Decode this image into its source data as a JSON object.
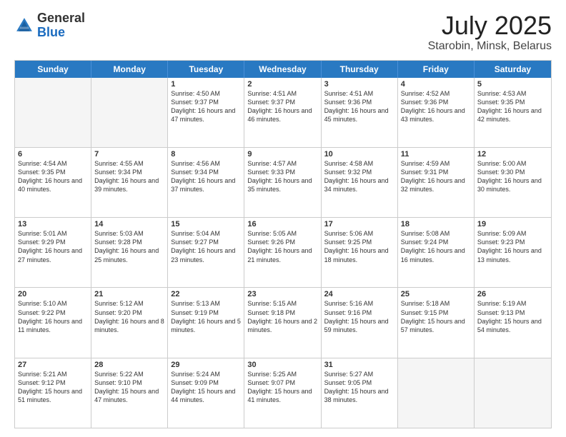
{
  "header": {
    "logo_line1": "General",
    "logo_line2": "Blue",
    "title": "July 2025",
    "subtitle": "Starobin, Minsk, Belarus"
  },
  "calendar": {
    "days": [
      "Sunday",
      "Monday",
      "Tuesday",
      "Wednesday",
      "Thursday",
      "Friday",
      "Saturday"
    ],
    "rows": [
      [
        {
          "day": "",
          "sunrise": "",
          "sunset": "",
          "daylight": "",
          "empty": true
        },
        {
          "day": "",
          "sunrise": "",
          "sunset": "",
          "daylight": "",
          "empty": true
        },
        {
          "day": "1",
          "sunrise": "Sunrise: 4:50 AM",
          "sunset": "Sunset: 9:37 PM",
          "daylight": "Daylight: 16 hours and 47 minutes."
        },
        {
          "day": "2",
          "sunrise": "Sunrise: 4:51 AM",
          "sunset": "Sunset: 9:37 PM",
          "daylight": "Daylight: 16 hours and 46 minutes."
        },
        {
          "day": "3",
          "sunrise": "Sunrise: 4:51 AM",
          "sunset": "Sunset: 9:36 PM",
          "daylight": "Daylight: 16 hours and 45 minutes."
        },
        {
          "day": "4",
          "sunrise": "Sunrise: 4:52 AM",
          "sunset": "Sunset: 9:36 PM",
          "daylight": "Daylight: 16 hours and 43 minutes."
        },
        {
          "day": "5",
          "sunrise": "Sunrise: 4:53 AM",
          "sunset": "Sunset: 9:35 PM",
          "daylight": "Daylight: 16 hours and 42 minutes."
        }
      ],
      [
        {
          "day": "6",
          "sunrise": "Sunrise: 4:54 AM",
          "sunset": "Sunset: 9:35 PM",
          "daylight": "Daylight: 16 hours and 40 minutes."
        },
        {
          "day": "7",
          "sunrise": "Sunrise: 4:55 AM",
          "sunset": "Sunset: 9:34 PM",
          "daylight": "Daylight: 16 hours and 39 minutes."
        },
        {
          "day": "8",
          "sunrise": "Sunrise: 4:56 AM",
          "sunset": "Sunset: 9:34 PM",
          "daylight": "Daylight: 16 hours and 37 minutes."
        },
        {
          "day": "9",
          "sunrise": "Sunrise: 4:57 AM",
          "sunset": "Sunset: 9:33 PM",
          "daylight": "Daylight: 16 hours and 35 minutes."
        },
        {
          "day": "10",
          "sunrise": "Sunrise: 4:58 AM",
          "sunset": "Sunset: 9:32 PM",
          "daylight": "Daylight: 16 hours and 34 minutes."
        },
        {
          "day": "11",
          "sunrise": "Sunrise: 4:59 AM",
          "sunset": "Sunset: 9:31 PM",
          "daylight": "Daylight: 16 hours and 32 minutes."
        },
        {
          "day": "12",
          "sunrise": "Sunrise: 5:00 AM",
          "sunset": "Sunset: 9:30 PM",
          "daylight": "Daylight: 16 hours and 30 minutes."
        }
      ],
      [
        {
          "day": "13",
          "sunrise": "Sunrise: 5:01 AM",
          "sunset": "Sunset: 9:29 PM",
          "daylight": "Daylight: 16 hours and 27 minutes."
        },
        {
          "day": "14",
          "sunrise": "Sunrise: 5:03 AM",
          "sunset": "Sunset: 9:28 PM",
          "daylight": "Daylight: 16 hours and 25 minutes."
        },
        {
          "day": "15",
          "sunrise": "Sunrise: 5:04 AM",
          "sunset": "Sunset: 9:27 PM",
          "daylight": "Daylight: 16 hours and 23 minutes."
        },
        {
          "day": "16",
          "sunrise": "Sunrise: 5:05 AM",
          "sunset": "Sunset: 9:26 PM",
          "daylight": "Daylight: 16 hours and 21 minutes."
        },
        {
          "day": "17",
          "sunrise": "Sunrise: 5:06 AM",
          "sunset": "Sunset: 9:25 PM",
          "daylight": "Daylight: 16 hours and 18 minutes."
        },
        {
          "day": "18",
          "sunrise": "Sunrise: 5:08 AM",
          "sunset": "Sunset: 9:24 PM",
          "daylight": "Daylight: 16 hours and 16 minutes."
        },
        {
          "day": "19",
          "sunrise": "Sunrise: 5:09 AM",
          "sunset": "Sunset: 9:23 PM",
          "daylight": "Daylight: 16 hours and 13 minutes."
        }
      ],
      [
        {
          "day": "20",
          "sunrise": "Sunrise: 5:10 AM",
          "sunset": "Sunset: 9:22 PM",
          "daylight": "Daylight: 16 hours and 11 minutes."
        },
        {
          "day": "21",
          "sunrise": "Sunrise: 5:12 AM",
          "sunset": "Sunset: 9:20 PM",
          "daylight": "Daylight: 16 hours and 8 minutes."
        },
        {
          "day": "22",
          "sunrise": "Sunrise: 5:13 AM",
          "sunset": "Sunset: 9:19 PM",
          "daylight": "Daylight: 16 hours and 5 minutes."
        },
        {
          "day": "23",
          "sunrise": "Sunrise: 5:15 AM",
          "sunset": "Sunset: 9:18 PM",
          "daylight": "Daylight: 16 hours and 2 minutes."
        },
        {
          "day": "24",
          "sunrise": "Sunrise: 5:16 AM",
          "sunset": "Sunset: 9:16 PM",
          "daylight": "Daylight: 15 hours and 59 minutes."
        },
        {
          "day": "25",
          "sunrise": "Sunrise: 5:18 AM",
          "sunset": "Sunset: 9:15 PM",
          "daylight": "Daylight: 15 hours and 57 minutes."
        },
        {
          "day": "26",
          "sunrise": "Sunrise: 5:19 AM",
          "sunset": "Sunset: 9:13 PM",
          "daylight": "Daylight: 15 hours and 54 minutes."
        }
      ],
      [
        {
          "day": "27",
          "sunrise": "Sunrise: 5:21 AM",
          "sunset": "Sunset: 9:12 PM",
          "daylight": "Daylight: 15 hours and 51 minutes."
        },
        {
          "day": "28",
          "sunrise": "Sunrise: 5:22 AM",
          "sunset": "Sunset: 9:10 PM",
          "daylight": "Daylight: 15 hours and 47 minutes."
        },
        {
          "day": "29",
          "sunrise": "Sunrise: 5:24 AM",
          "sunset": "Sunset: 9:09 PM",
          "daylight": "Daylight: 15 hours and 44 minutes."
        },
        {
          "day": "30",
          "sunrise": "Sunrise: 5:25 AM",
          "sunset": "Sunset: 9:07 PM",
          "daylight": "Daylight: 15 hours and 41 minutes."
        },
        {
          "day": "31",
          "sunrise": "Sunrise: 5:27 AM",
          "sunset": "Sunset: 9:05 PM",
          "daylight": "Daylight: 15 hours and 38 minutes."
        },
        {
          "day": "",
          "sunrise": "",
          "sunset": "",
          "daylight": "",
          "empty": true
        },
        {
          "day": "",
          "sunrise": "",
          "sunset": "",
          "daylight": "",
          "empty": true
        }
      ]
    ]
  }
}
